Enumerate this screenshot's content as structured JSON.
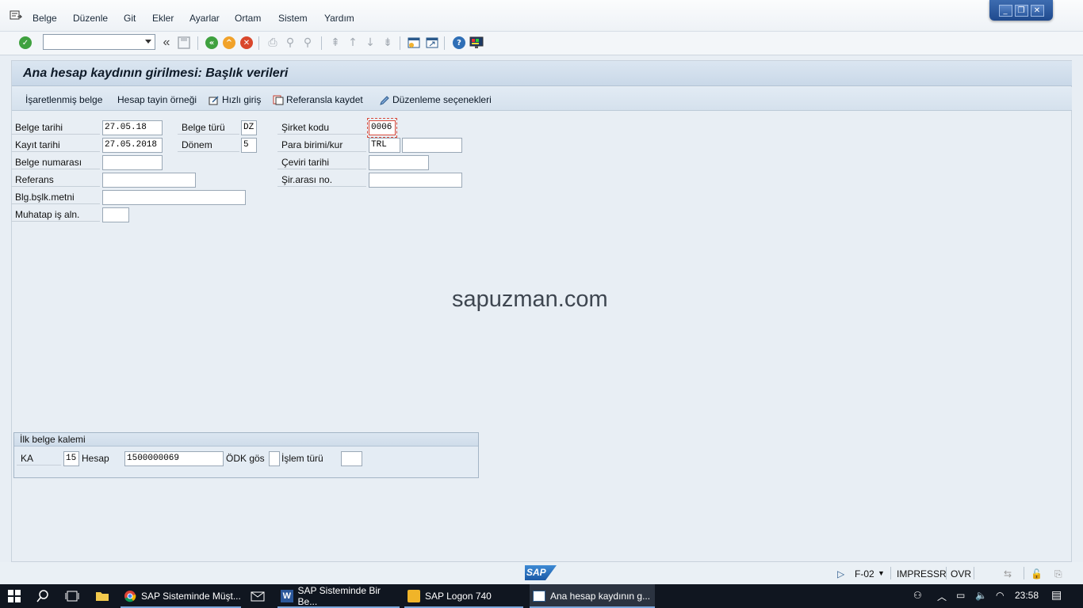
{
  "menu": {
    "items": [
      "Belge",
      "Düzenle",
      "Git",
      "Ekler",
      "Ayarlar",
      "Ortam",
      "Sistem",
      "Yardım"
    ]
  },
  "window_controls": {
    "minimize": "_",
    "restore": "❐",
    "close": "✕"
  },
  "toolbar": {
    "command_field_value": "",
    "back_double": "«"
  },
  "screen": {
    "title": "Ana hesap kaydının girilmesi: Başlık verileri",
    "app_buttons": [
      "İşaretlenmiş belge",
      "Hesap tayin örneği",
      "Hızlı giriş",
      "Referansla kaydet",
      "Düzenleme seçenekleri"
    ]
  },
  "header_fields": {
    "belge_tarihi": {
      "label": "Belge tarihi",
      "value": "27.05.18"
    },
    "kayit_tarihi": {
      "label": "Kayıt tarihi",
      "value": "27.05.2018"
    },
    "belge_numarasi": {
      "label": "Belge numarası",
      "value": ""
    },
    "referans": {
      "label": "Referans",
      "value": ""
    },
    "baslik_metni": {
      "label": "Blg.bşlk.metni",
      "value": ""
    },
    "muhatap": {
      "label": "Muhatap iş aln.",
      "value": ""
    },
    "belge_turu": {
      "label": "Belge türü",
      "value": "DZ"
    },
    "donem": {
      "label": "Dönem",
      "value": "5"
    },
    "sirket_kodu": {
      "label": "Şirket kodu",
      "value": "0006"
    },
    "para_birimi": {
      "label": "Para birimi/kur",
      "value": "TRL",
      "rate": ""
    },
    "ceviri_tarihi": {
      "label": "Çeviri tarihi",
      "value": ""
    },
    "sirarasi_no": {
      "label": "Şir.arası no.",
      "value": ""
    }
  },
  "watermark": "sapuzman.com",
  "first_item": {
    "title": "İlk belge kalemi",
    "ka_label": "KA",
    "ka_value": "15",
    "hesap_label": "Hesap",
    "hesap_value": "1500000069",
    "odk_label": "ÖDK gös",
    "odk_value": "",
    "islem_label": "İşlem türü",
    "islem_value": ""
  },
  "status": {
    "sap_logo": "SAP",
    "transaction": "F-02",
    "server": "IMPRESSR",
    "mode": "OVR"
  },
  "taskbar": {
    "apps": [
      "SAP Sisteminde Müşt...",
      "SAP Sisteminde Bir Be...",
      "SAP Logon 740",
      "Ana hesap kaydının g..."
    ],
    "time": "23:58"
  },
  "colors": {
    "title_bg": "#c9d8e8",
    "required_border": "#d94b3c",
    "taskbar_bg": "#101620"
  }
}
